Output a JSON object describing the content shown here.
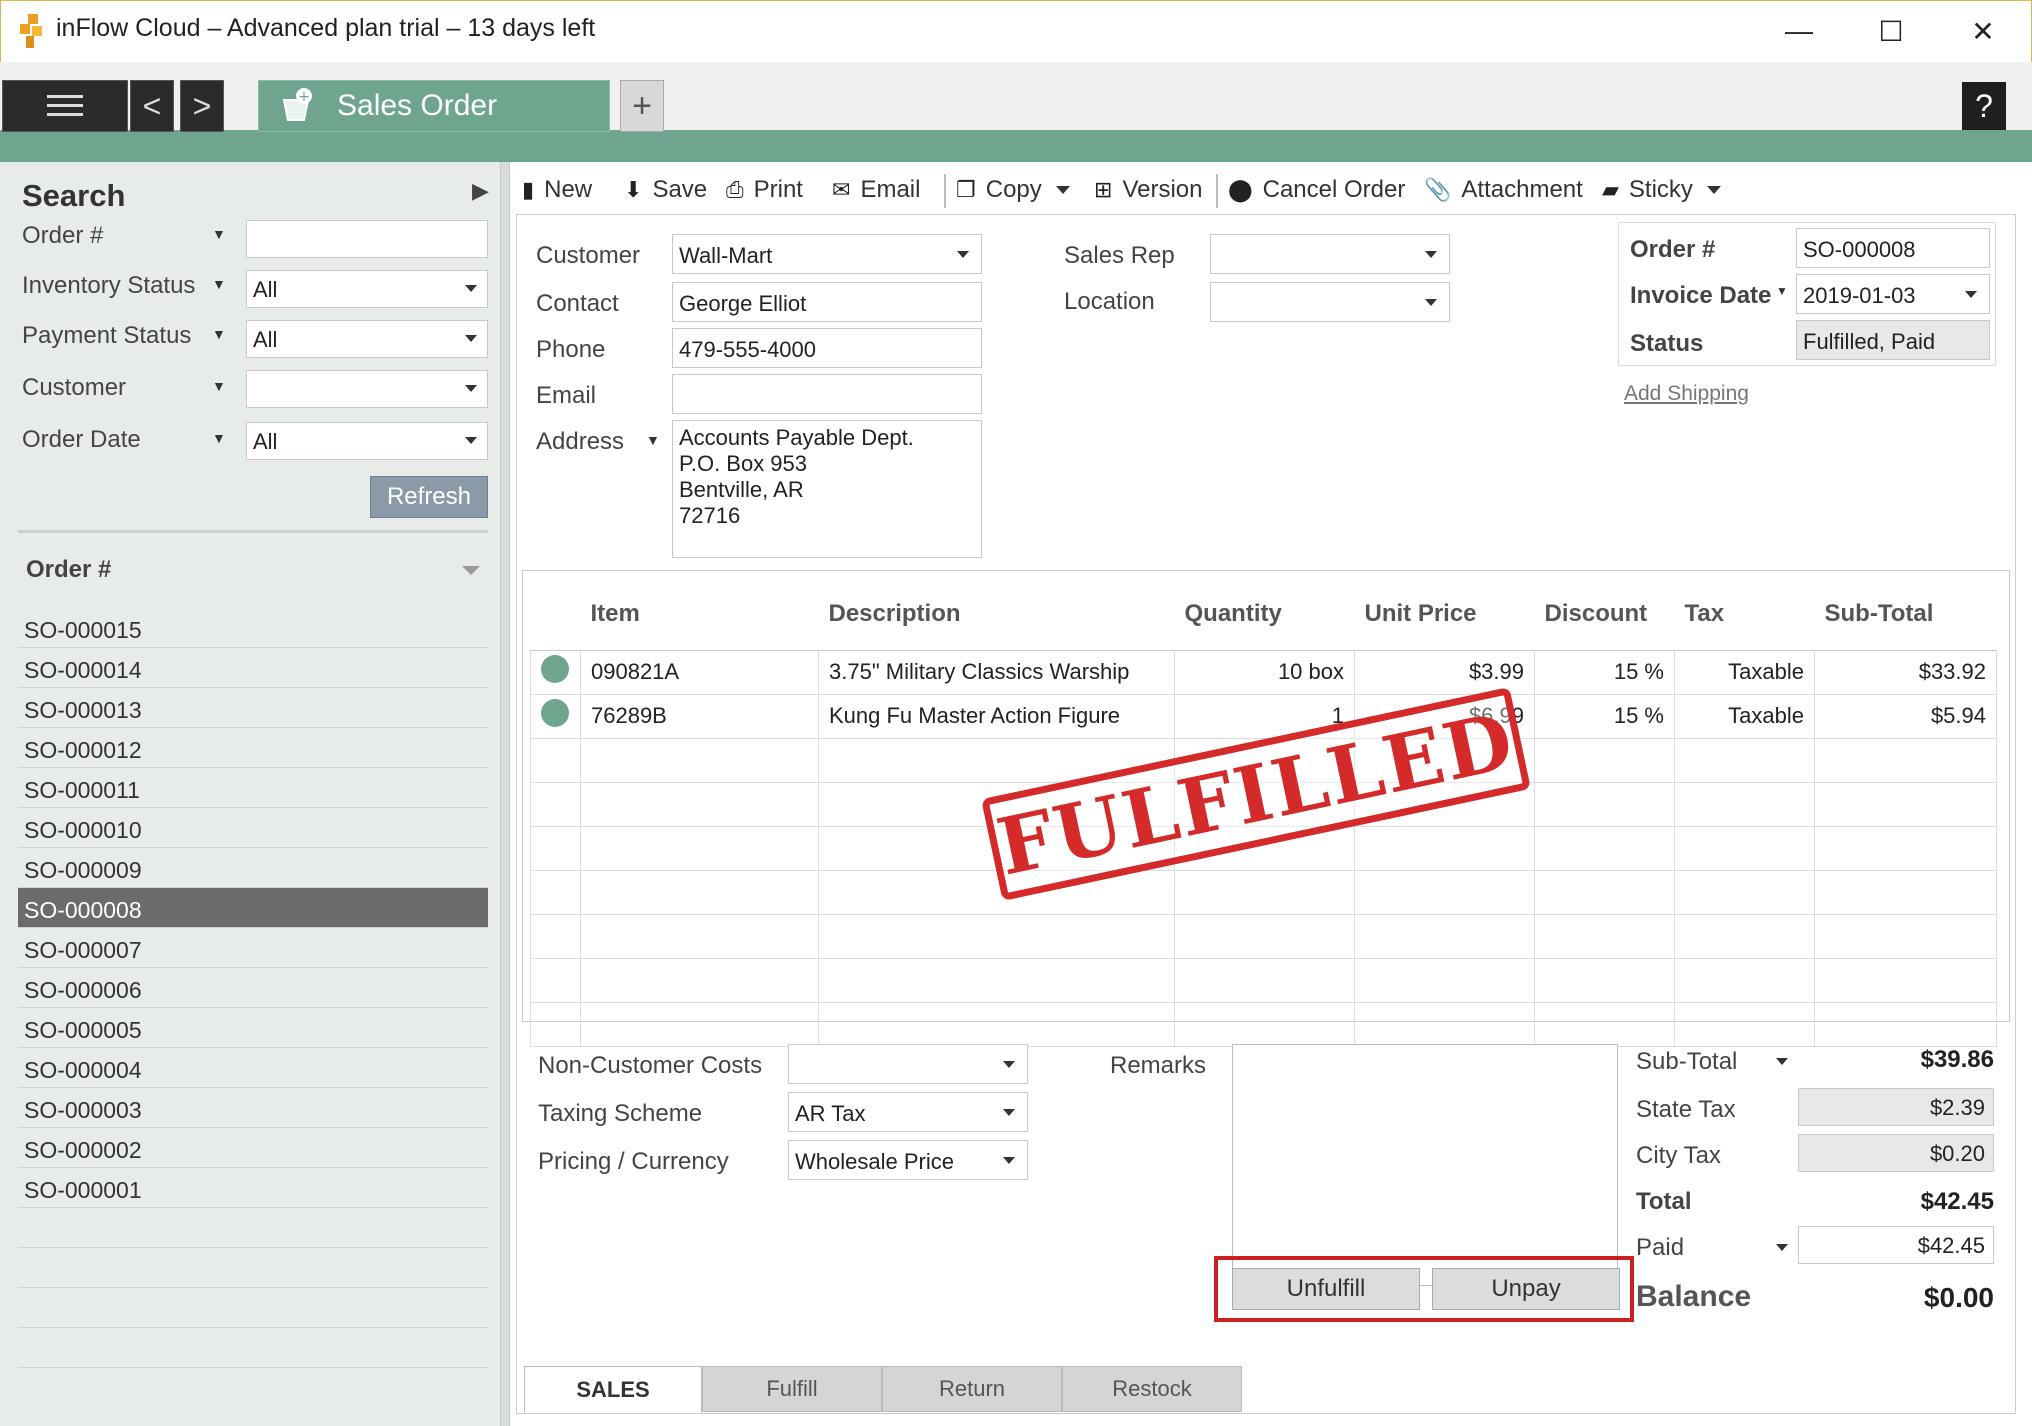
{
  "window": {
    "title": "inFlow Cloud – Advanced plan trial – 13 days left",
    "minimize": "—",
    "maximize": "☐",
    "close": "✕"
  },
  "nav": {
    "back": "<",
    "forward": ">",
    "active_tab": "Sales Order",
    "new_tab": "+",
    "help": "?"
  },
  "search": {
    "heading": "Search",
    "collapse": "▶",
    "filters": [
      {
        "label": "Order #",
        "value": ""
      },
      {
        "label": "Inventory Status",
        "value": "All"
      },
      {
        "label": "Payment Status",
        "value": "All"
      },
      {
        "label": "Customer",
        "value": ""
      },
      {
        "label": "Order Date",
        "value": "All"
      }
    ],
    "refresh": "Refresh",
    "list_header": "Order #",
    "orders": [
      "SO-000015",
      "SO-000014",
      "SO-000013",
      "SO-000012",
      "SO-000011",
      "SO-000010",
      "SO-000009",
      "SO-000008",
      "SO-000007",
      "SO-000006",
      "SO-000005",
      "SO-000004",
      "SO-000003",
      "SO-000002",
      "SO-000001"
    ],
    "selected": "SO-000008"
  },
  "toolbar": {
    "new": "New",
    "save": "Save",
    "print": "Print",
    "email": "Email",
    "copy": "Copy",
    "version": "Version",
    "cancel_order": "Cancel Order",
    "attachment": "Attachment",
    "sticky": "Sticky"
  },
  "customer": {
    "customer_label": "Customer",
    "customer": "Wall-Mart",
    "contact_label": "Contact",
    "contact": "George Elliot",
    "phone_label": "Phone",
    "phone": "479-555-4000",
    "email_label": "Email",
    "email": "",
    "address_label": "Address",
    "address": [
      "Accounts Payable Dept.",
      "P.O. Box 953",
      "Bentville, AR",
      "72716"
    ],
    "sales_rep_label": "Sales Rep",
    "sales_rep": "",
    "location_label": "Location",
    "location": ""
  },
  "order": {
    "order_no_label": "Order #",
    "order_no": "SO-000008",
    "invoice_date_label": "Invoice Date",
    "invoice_date": "2019-01-03",
    "status_label": "Status",
    "status": "Fulfilled, Paid",
    "add_shipping": "Add Shipping"
  },
  "grid": {
    "columns": [
      "Item",
      "Description",
      "Quantity",
      "Unit Price",
      "Discount",
      "Tax",
      "Sub-Total"
    ],
    "rows": [
      {
        "item": "090821A",
        "description": "3.75\" Military Classics Warship",
        "quantity": "10 box",
        "unit_price": "$3.99",
        "discount": "15 %",
        "tax": "Taxable",
        "subtotal": "$33.92"
      },
      {
        "item": "76289B",
        "description": "Kung Fu Master Action Figure",
        "quantity": "1",
        "unit_price": "$6.99",
        "discount": "15 %",
        "tax": "Taxable",
        "subtotal": "$5.94"
      }
    ],
    "stamp": "FULFILLED"
  },
  "bottom": {
    "non_customer_costs_label": "Non-Customer Costs",
    "non_customer_costs": "",
    "taxing_scheme_label": "Taxing Scheme",
    "taxing_scheme": "AR Tax",
    "pricing_label": "Pricing / Currency",
    "pricing": "Wholesale Price",
    "remarks_label": "Remarks",
    "unfulfill": "Unfulfill",
    "unpay": "Unpay"
  },
  "totals": {
    "subtotal_label": "Sub-Total",
    "subtotal": "$39.86",
    "state_tax_label": "State Tax",
    "state_tax": "$2.39",
    "city_tax_label": "City Tax",
    "city_tax": "$0.20",
    "total_label": "Total",
    "total": "$42.45",
    "paid_label": "Paid",
    "paid": "$42.45",
    "balance_label": "Balance",
    "balance": "$0.00"
  },
  "bottom_tabs": [
    "SALES",
    "Fulfill",
    "Return",
    "Restock"
  ],
  "colors": {
    "accent_green": "#6fa58f",
    "stamp_red": "#d42a2a",
    "highlight_red": "#cc1f1f"
  }
}
